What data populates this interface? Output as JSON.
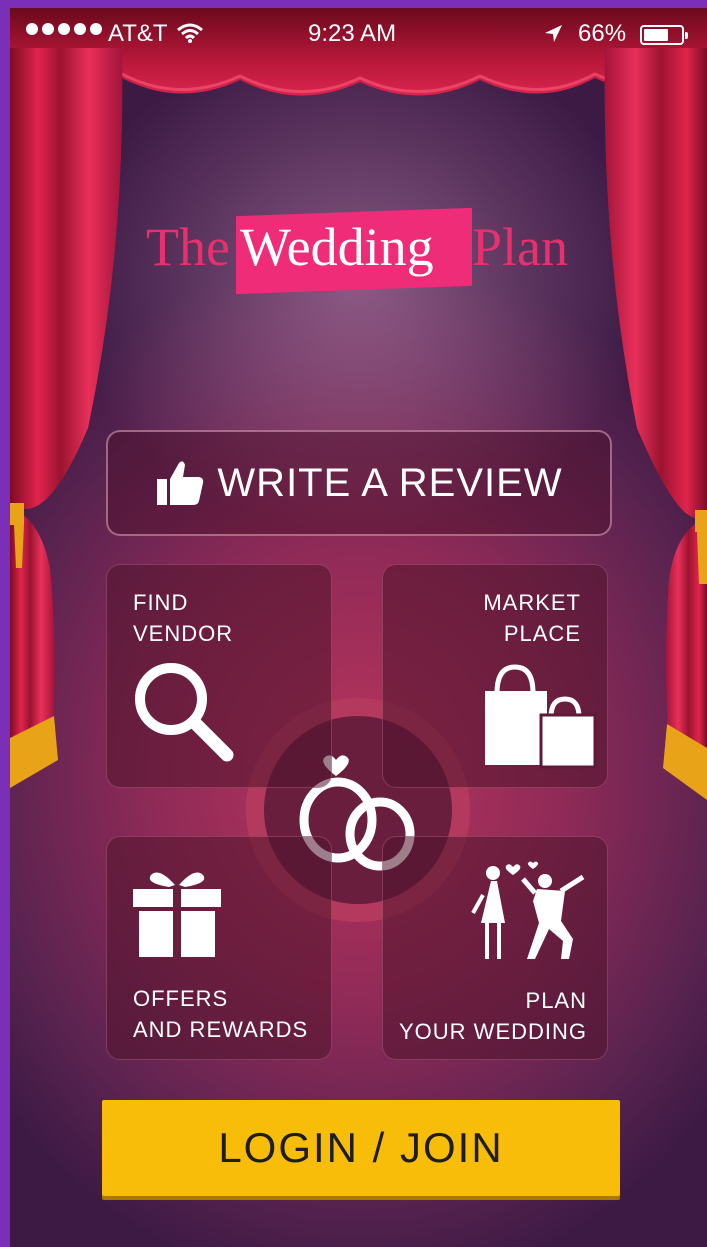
{
  "status_bar": {
    "carrier": "AT&T",
    "time": "9:23 AM",
    "battery": "66%",
    "battery_level": 0.66
  },
  "logo": {
    "part1": "The",
    "part2": "Wedding",
    "part3": "Plan"
  },
  "review_button": {
    "label": "WRITE A REVIEW",
    "icon": "thumbs-up-icon"
  },
  "tiles": {
    "find_vendor": {
      "line1": "FIND",
      "line2": "VENDOR",
      "icon": "magnifier-icon"
    },
    "market_place": {
      "line1": "MARKET",
      "line2": "PLACE",
      "icon": "shopping-bags-icon"
    },
    "offers": {
      "line1": "OFFERS",
      "line2": "AND REWARDS",
      "icon": "gift-icon"
    },
    "plan": {
      "line1": "PLAN",
      "line2": "YOUR WEDDING",
      "icon": "couple-icon"
    }
  },
  "center_icon": "wedding-rings-icon",
  "login_button": {
    "label": "LOGIN / JOIN"
  },
  "colors": {
    "accent_pink": "#ee2c78",
    "login_yellow": "#f7bd08",
    "frame_purple": "#7b2fb8",
    "curtain_red": "#d51b45",
    "tassel_gold": "#e8a318"
  }
}
